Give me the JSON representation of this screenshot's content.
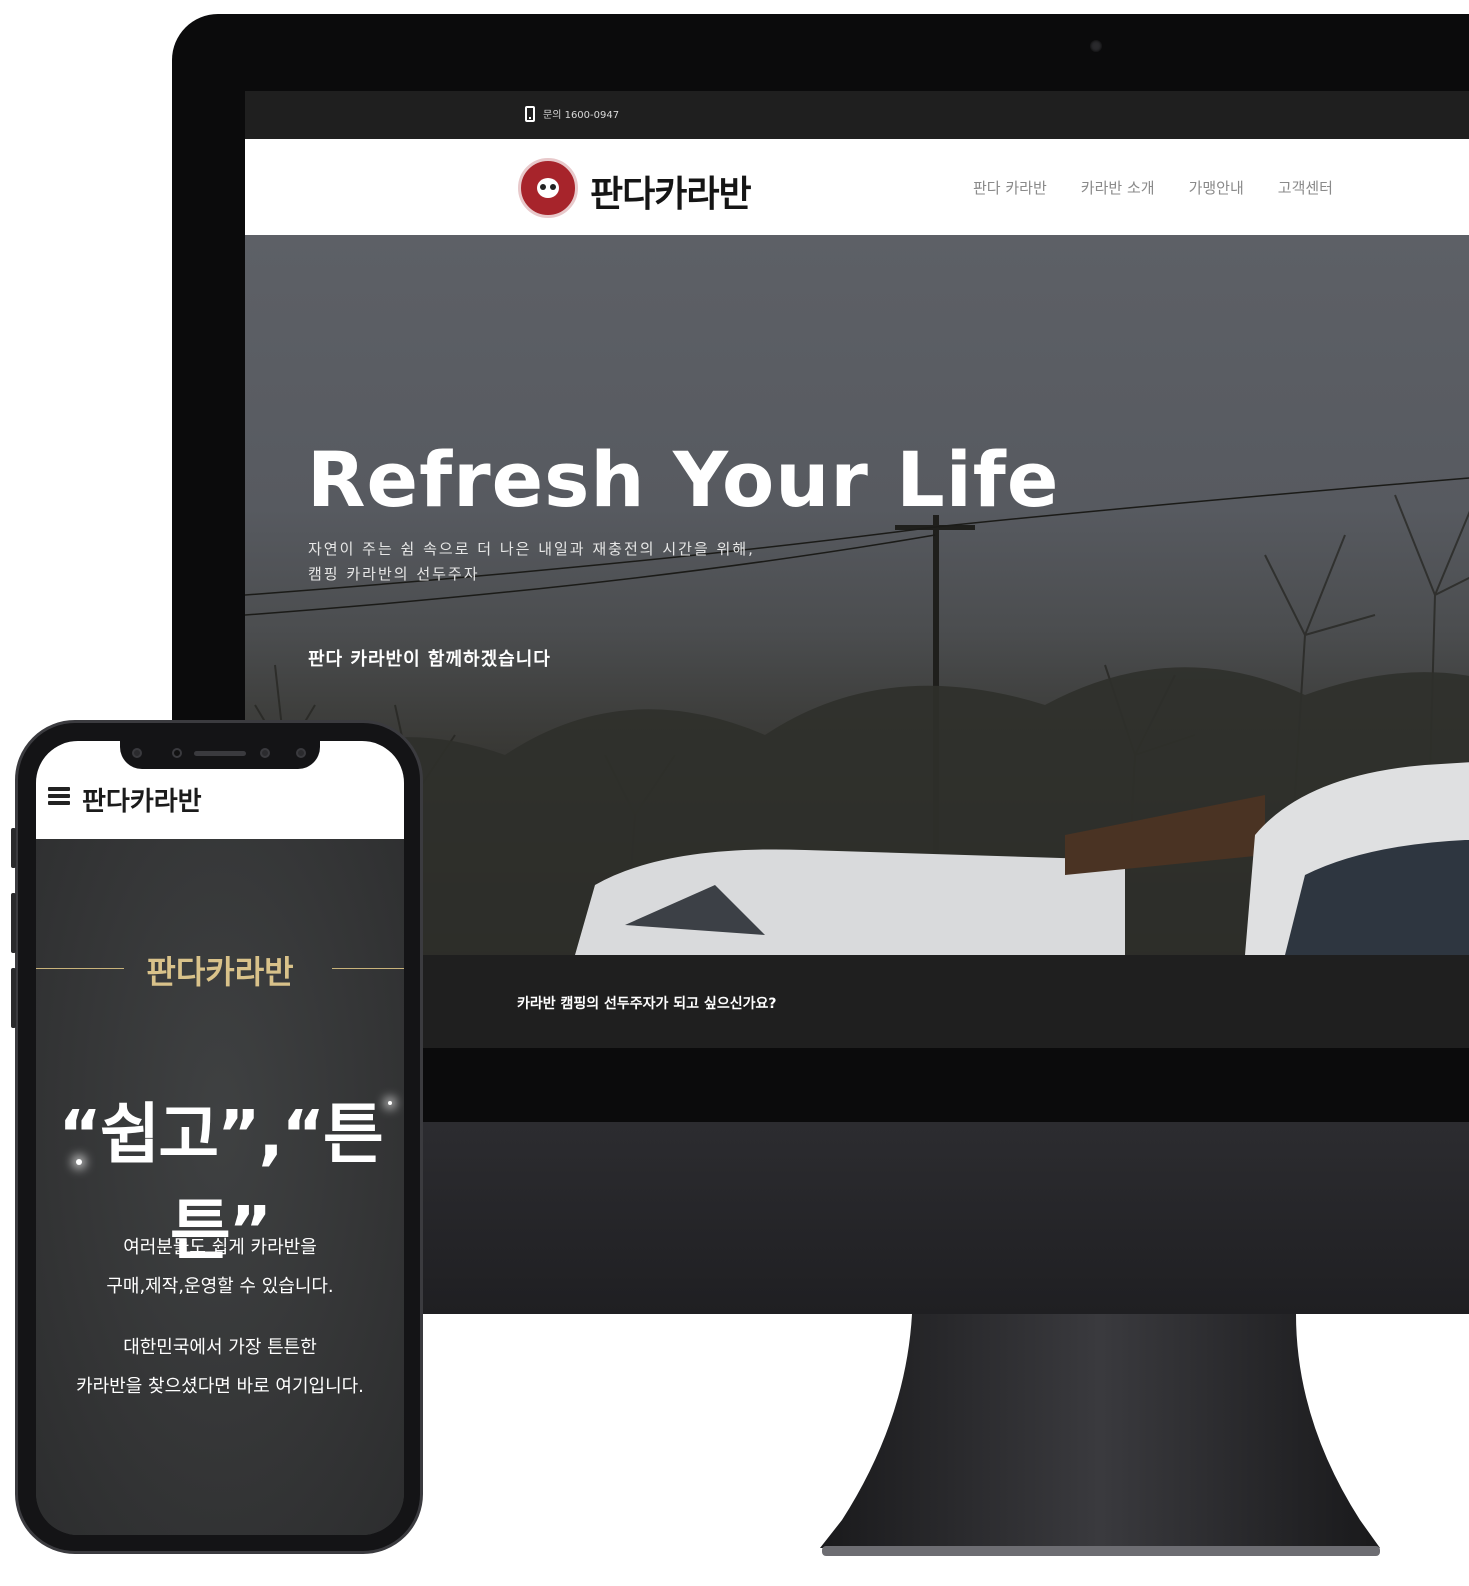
{
  "desktop": {
    "topbar": {
      "phone_icon": "mobile-phone-icon",
      "contact": "문의 1600-0947"
    },
    "header": {
      "logo_text": "판다카라반",
      "nav": [
        "판다 카라반",
        "카라반 소개",
        "가맹안내",
        "고객센터"
      ]
    },
    "hero": {
      "title": "Refresh Your Life",
      "subtitle_line1": "자연이 주는 쉼 속으로 더 나은 내일과 재충전의 시간을 위해,",
      "subtitle_line2": "캠핑 카라반의 선두주자",
      "cta": "판다 카라반이 함께하겠습니다"
    },
    "promo": {
      "text": "카라반 캠핑의 선두주자가 되고 싶으신가요?"
    }
  },
  "mobile": {
    "header": {
      "menu_icon": "hamburger-menu-icon",
      "logo_text": "판다카라반"
    },
    "body": {
      "brand": "판다카라반",
      "quote": "“쉽고”,“튼튼”",
      "desc1_line1": "여러분들도 쉽게 카라반을",
      "desc1_line2": "구매,제작,운영할 수 있습니다.",
      "desc2_line1": "대한민국에서 가장 튼튼한",
      "desc2_line2": "카라반을 찾으셨다면 바로 여기입니다."
    }
  },
  "colors": {
    "brand_red": "#a7242b",
    "gold": "#d9c28a",
    "dark_band": "#1f1f1f"
  }
}
